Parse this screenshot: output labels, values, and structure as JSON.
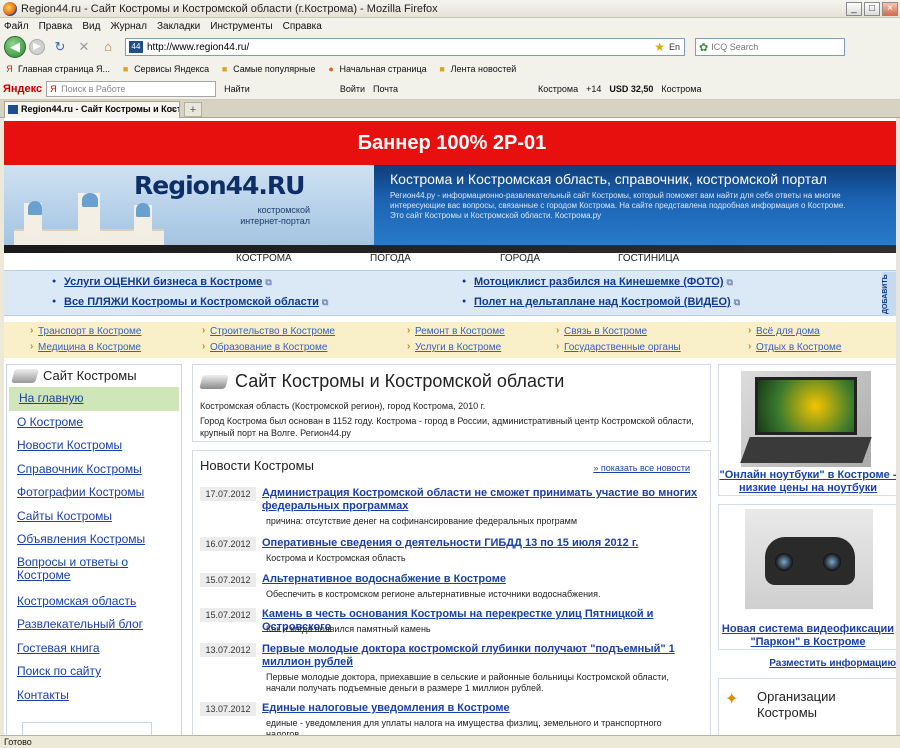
{
  "window": {
    "title": "Region44.ru - Сайт Костромы и Костромской области (г.Кострома) - Mozilla Firefox",
    "controls": {
      "minimize": "_",
      "maximize": "□",
      "close": "×"
    }
  },
  "menu": [
    "Файл",
    "Правка",
    "Вид",
    "Журнал",
    "Закладки",
    "Инструменты",
    "Справка"
  ],
  "nav": {
    "url": "http://www.region44.ru/",
    "site_badge": "44",
    "lang": "En",
    "search_placeholder": "ICQ Search",
    "back_glyph": "◀",
    "forward_glyph": "▶",
    "reload_glyph": "↻",
    "stop_glyph": "✕",
    "home_glyph": "⌂"
  },
  "bookmarks": [
    "Главная страница Я...",
    "Сервисы Яндекса",
    "Самые популярные",
    "Начальная страница",
    "Лента новостей"
  ],
  "yandex_bar": {
    "logo": "Яндекс",
    "search_placeholder": "Поиск в Работе",
    "find": "Найти",
    "login": "Войти",
    "mail": "Почта",
    "city": "Кострома",
    "temp": "+14",
    "usd": "USD 32,50",
    "city2": "Кострома"
  },
  "tab": {
    "label": "Region44.ru - Сайт Костромы и Кост...",
    "close": "×",
    "new": "+"
  },
  "status": "Готово",
  "page": {
    "banner": "Баннер 100% 2P-01",
    "logo": "Region44.RU",
    "logo_sub": "костромской интернет-портал",
    "header_title": "Кострома и Костромская область, справочник, костромской портал",
    "header_text": "Регион44.ру - информационно-развлекательный сайт Костромы, который поможет вам найти для себя ответы на многие интересующие вас вопросы, связанные с городом Кострома. На сайте представлена подробная информация о Костроме. Это сайт Костромы и Костромской области. Кострома.ру",
    "topnav": [
      "КОСТРОМА",
      "ПОГОДА",
      "ГОРОДА",
      "ГОСТИНИЦА"
    ],
    "hot_links": [
      "Услуги ОЦЕНКИ бизнеса в Костроме",
      "Все ПЛЯЖИ Костромы и Костромской области",
      "Мотоциклист разбился на Кинешемке (ФОТО)",
      "Полет на дельтаплане над Костромой (ВИДЕО)"
    ],
    "add_button": "ДОБАВИТЬ",
    "categories": [
      "Транспорт в Костроме",
      "Строительство в Костроме",
      "Ремонт в Костроме",
      "Связь в Костроме",
      "Всё для дома",
      "Медицина в Костроме",
      "Образование в Костроме",
      "Услуги в Костроме",
      "Государственные органы",
      "Отдых в Костроме"
    ],
    "left_menu": {
      "title": "Сайт Костромы",
      "items": [
        "На главную",
        "О Костроме",
        "Новости Костромы",
        "Справочник Костромы",
        "Фотографии Костромы",
        "Сайты Костромы",
        "Объявления Костромы",
        "Вопросы и ответы о Костроме",
        "Костромская область",
        "Развлекательный блог",
        "Гостевая книга",
        "Поиск по сайту",
        "Контакты"
      ]
    },
    "intro": {
      "title": "Сайт Костромы и Костромской области",
      "subtitle": "Костромская область (Костромской регион), город Кострома, 2010 г.",
      "text": "Город Кострома был основан в 1152 году. Кострома - город в России, административный центр Костромской области, крупный порт на Волге. Регион44.ру"
    },
    "news": {
      "title": "Новости Костромы",
      "all": "показать все новости",
      "items": [
        {
          "date": "17.07.2012",
          "headline": "Администрация Костромской области не сможет принимать участие во многих федеральных программах",
          "summary": "причина: отсутствие денег на софинансирование федеральных программ"
        },
        {
          "date": "16.07.2012",
          "headline": "Оперативные сведения о деятельности ГИБДД 13 по 15 июля 2012 г.",
          "summary": "Кострома и Костромская область"
        },
        {
          "date": "15.07.2012",
          "headline": "Альтернативное водоснабжение в Костроме",
          "summary": "Обеспечить в костромском регионе альтернативные источники водоснабжения."
        },
        {
          "date": "15.07.2012",
          "headline": "Камень в честь основания Костромы на перекрестке улиц Пятницкой и Островского",
          "summary": "Как и когда появился памятный камень"
        },
        {
          "date": "13.07.2012",
          "headline": "Первые молодые доктора костромской глубинки получают \"подъемный\" 1 миллион рублей",
          "summary": "Первые молодые доктора, приехавшие в сельские и районные больницы Костромской области, начали получать подъемные деньги в размере 1 миллион рублей."
        },
        {
          "date": "13.07.2012",
          "headline": "Единые налоговые уведомления в Костроме",
          "summary": "единые - уведомления для уплаты налога на имущества физлиц, земельного и транспортного налогов"
        }
      ]
    },
    "right": {
      "ad1": "\"Онлайн ноутбуки\" в Костроме - низкие цены на ноутбуки",
      "ad2": "Новая система видеофиксации \"Паркон\" в Костроме",
      "place_info": "Разместить информацию",
      "org_title": "Организации Костромы"
    }
  }
}
